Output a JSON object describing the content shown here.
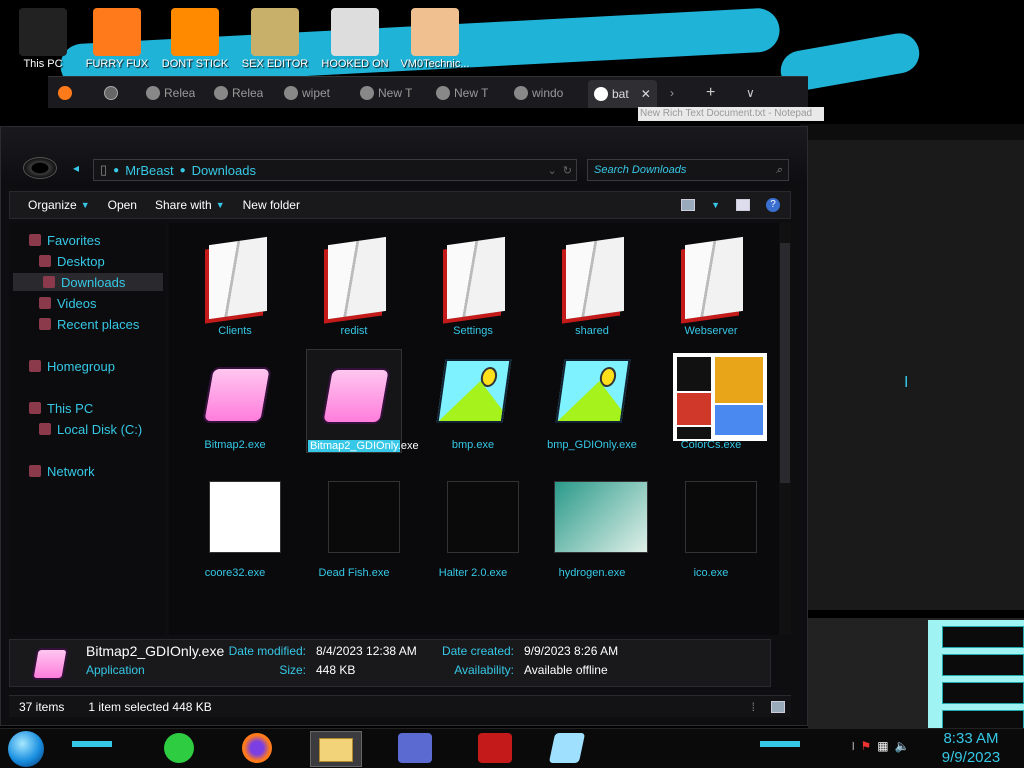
{
  "desktop": {
    "icons": [
      {
        "label": "This PC",
        "icon": "computer-icon",
        "color": "#222222"
      },
      {
        "label": "FURRY FUX",
        "icon": "firefox-icon",
        "color": "#ff7a1a"
      },
      {
        "label": "DONT STICK",
        "icon": "vlc-cone-icon",
        "color": "#ff8a00"
      },
      {
        "label": "SEX EDITOR",
        "icon": "hxd-icon",
        "color": "#c8b06a"
      },
      {
        "label": "HOOKED ON",
        "icon": "maze-icon",
        "color": "#dddddd"
      },
      {
        "label": "VM0Technic...",
        "icon": "doctor-icon",
        "color": "#f0c090"
      }
    ]
  },
  "browser": {
    "tabs": [
      {
        "label": "Relea",
        "icon": "back-icon"
      },
      {
        "label": "Relea",
        "icon": "github-icon"
      },
      {
        "label": "wipet",
        "icon": "wipe-icon"
      },
      {
        "label": "New T",
        "icon": "firefox-icon"
      },
      {
        "label": "New T",
        "icon": "firefox-icon"
      },
      {
        "label": "windo",
        "icon": "rss-icon"
      },
      {
        "label": "bat",
        "icon": "google-icon",
        "active": true
      }
    ],
    "close_glyph": "✕",
    "new_tab_glyph": "+",
    "tab_list_glyph": "∨"
  },
  "notepad_tooltip": "New Rich Text Document.txt - Notepad",
  "explorer": {
    "breadcrumb": [
      "MrBeast",
      "Downloads"
    ],
    "search_placeholder": "Search Downloads",
    "toolbar": {
      "organize": "Organize",
      "open": "Open",
      "share_with": "Share with",
      "new_folder": "New folder",
      "help": "?"
    },
    "sidebar": [
      {
        "label": "Favorites",
        "indent": 0
      },
      {
        "label": "Desktop",
        "indent": 1
      },
      {
        "label": "Downloads",
        "indent": 1,
        "selected": true
      },
      {
        "label": "Videos",
        "indent": 1
      },
      {
        "label": "Recent places",
        "indent": 1
      },
      {
        "label": "Homegroup",
        "indent": 0
      },
      {
        "label": "This PC",
        "indent": 0
      },
      {
        "label": "Local Disk (C:)",
        "indent": 1
      },
      {
        "label": "Network",
        "indent": 0
      }
    ],
    "files": [
      {
        "name": "Clients",
        "kind": "folder"
      },
      {
        "name": "redist",
        "kind": "folder"
      },
      {
        "name": "Settings",
        "kind": "folder"
      },
      {
        "name": "shared",
        "kind": "folder"
      },
      {
        "name": "Webserver",
        "kind": "folder"
      },
      {
        "name": "Bitmap2.exe",
        "kind": "pink"
      },
      {
        "name": "Bitmap2_GDIOnly.exe",
        "kind": "pink",
        "selected": true
      },
      {
        "name": "bmp.exe",
        "kind": "picture"
      },
      {
        "name": "bmp_GDIOnly.exe",
        "kind": "picture"
      },
      {
        "name": "ColorCs.exe",
        "kind": "colors"
      },
      {
        "name": "coore32.exe",
        "kind": "anime"
      },
      {
        "name": "Dead Fish.exe",
        "kind": "fish"
      },
      {
        "name": "Halter 2.0.exe",
        "kind": "halter"
      },
      {
        "name": "hydrogen.exe",
        "kind": "window"
      },
      {
        "name": "ico.exe",
        "kind": "globe"
      }
    ],
    "details": {
      "file_name": "Bitmap2_GDIOnly.exe",
      "file_type": "Application",
      "date_modified_label": "Date modified:",
      "date_modified": "8/4/2023 12:38 AM",
      "size_label": "Size:",
      "size": "448 KB",
      "date_created_label": "Date created:",
      "date_created": "9/9/2023 8:26 AM",
      "availability_label": "Availability:",
      "availability": "Available offline"
    },
    "status": {
      "items": "37 items",
      "selection": "1 item selected  448 KB"
    }
  },
  "taskbar": {
    "time": "8:33 AM",
    "date": "9/9/2023",
    "tray_icons": [
      "show-desktop-icon",
      "flag-icon",
      "network-icon",
      "volume-icon"
    ]
  },
  "colors": {
    "accent": "#36c8e6",
    "selection_fill": "#36c8e6"
  }
}
